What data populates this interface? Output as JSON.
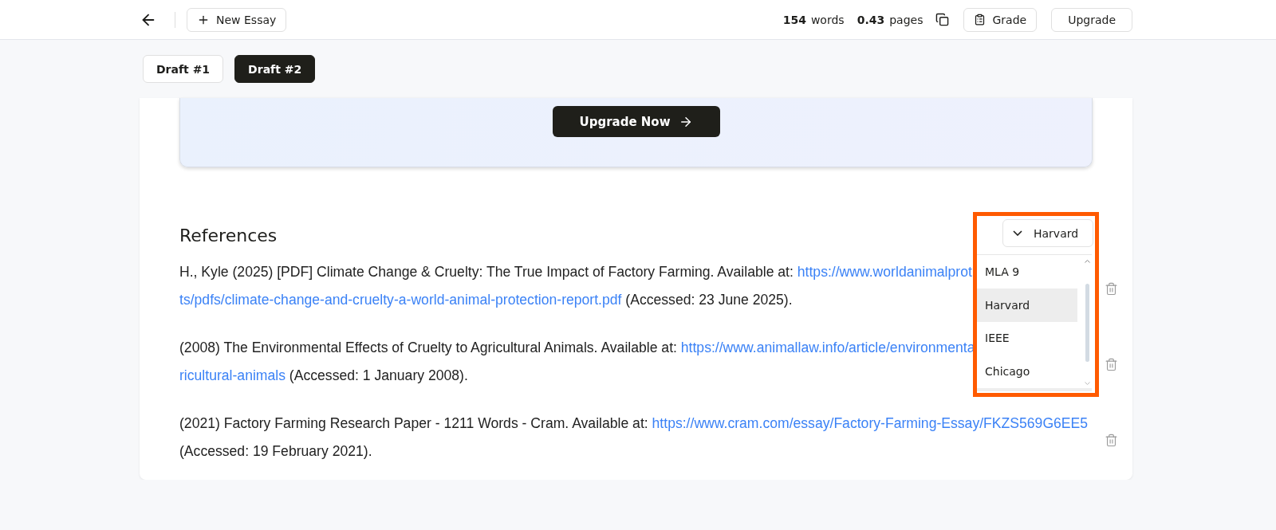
{
  "header": {
    "new_essay": "New Essay",
    "stats": [
      {
        "value": "154",
        "unit": "words"
      },
      {
        "value": "0.43",
        "unit": "pages"
      }
    ],
    "buttons": [
      {
        "label": "Grade",
        "kind": "grade"
      },
      {
        "label": "Upgrade",
        "kind": "plain"
      }
    ]
  },
  "drafts": [
    {
      "label": "Draft #1",
      "selected": false
    },
    {
      "label": "Draft #2",
      "selected": true
    }
  ],
  "banner": {
    "button": "Upgrade Now"
  },
  "references": {
    "title": "References",
    "style_picker": {
      "value": "Harvard",
      "highlighted": true,
      "options": [
        {
          "label": "MLA 9",
          "selected": false
        },
        {
          "label": "Harvard",
          "selected": true
        },
        {
          "label": "IEEE",
          "selected": false
        },
        {
          "label": "Chicago",
          "selected": false
        }
      ]
    },
    "items": [
      {
        "lines": [
          [
            {
              "kind": "text",
              "text": "H., Kyle (2025) [PDF] Climate Change & Cruelty: The True Impact of Factory Farming. Available at: "
            },
            {
              "kind": "link",
              "text": "https://www.worldanimalprot"
            }
          ],
          [
            {
              "kind": "link",
              "text": "ts/pdfs/climate-change-and-cruelty-a-world-animal-protection-report.pdf"
            },
            {
              "kind": "text",
              "text": " (Accessed: 23 June 2025)."
            }
          ]
        ]
      },
      {
        "lines": [
          [
            {
              "kind": "text",
              "text": "(2008) The Environmental Effects of Cruelty to Agricultural Animals. Available at: "
            },
            {
              "kind": "link",
              "text": "https://www.animallaw.info/article/environmenta"
            }
          ],
          [
            {
              "kind": "link",
              "text": "ricultural-animals"
            },
            {
              "kind": "text",
              "text": " (Accessed: 1 January 2008)."
            }
          ]
        ]
      },
      {
        "lines": [
          [
            {
              "kind": "text",
              "text": "(2021) Factory Farming Research Paper - 1211 Words - Cram. Available at: "
            },
            {
              "kind": "link",
              "text": "https://www.cram.com/essay/Factory-Farming-Essay/FKZS569G6EE5"
            }
          ],
          [
            {
              "kind": "text",
              "text": "(Accessed: 19 February 2021)."
            }
          ]
        ]
      }
    ]
  }
}
